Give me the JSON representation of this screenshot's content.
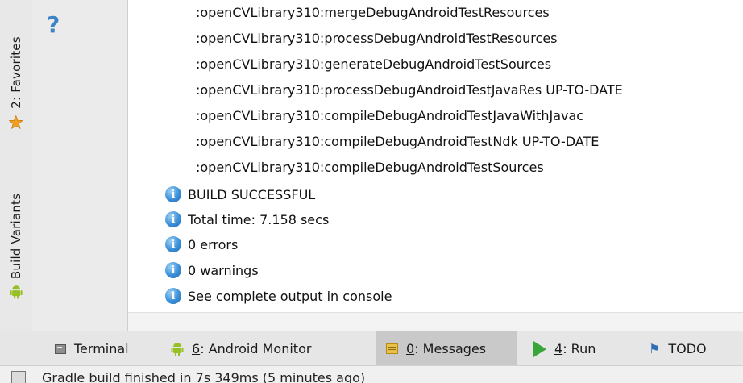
{
  "left_strip": {
    "favorites_label": "2: Favorites",
    "build_variants_label": "Build Variants"
  },
  "side_column": {
    "help_icon": "?"
  },
  "messages": {
    "tasks": [
      ":openCVLibrary310:mergeDebugAndroidTestResources",
      ":openCVLibrary310:processDebugAndroidTestResources",
      ":openCVLibrary310:generateDebugAndroidTestSources",
      ":openCVLibrary310:processDebugAndroidTestJavaRes UP-TO-DATE",
      ":openCVLibrary310:compileDebugAndroidTestJavaWithJavac",
      ":openCVLibrary310:compileDebugAndroidTestNdk UP-TO-DATE",
      ":openCVLibrary310:compileDebugAndroidTestSources"
    ],
    "info": [
      "BUILD SUCCESSFUL",
      "Total time: 7.158 secs",
      "0 errors",
      "0 warnings",
      "See complete output in console"
    ]
  },
  "tool_tabs": {
    "terminal": "Terminal",
    "android_monitor_number": "6",
    "android_monitor_rest": ": Android Monitor",
    "messages_number": "0",
    "messages_rest": ": Messages",
    "run_number": "4",
    "run_rest": ": Run",
    "todo": "TODO"
  },
  "status_bar": {
    "text": "Gradle build finished in 7s 349ms (5 minutes ago)"
  },
  "colors": {
    "info_icon": "#3a8fd8",
    "run_icon": "#3aa539",
    "android_green": "#97c024",
    "active_tab": "#c9c9c9"
  }
}
